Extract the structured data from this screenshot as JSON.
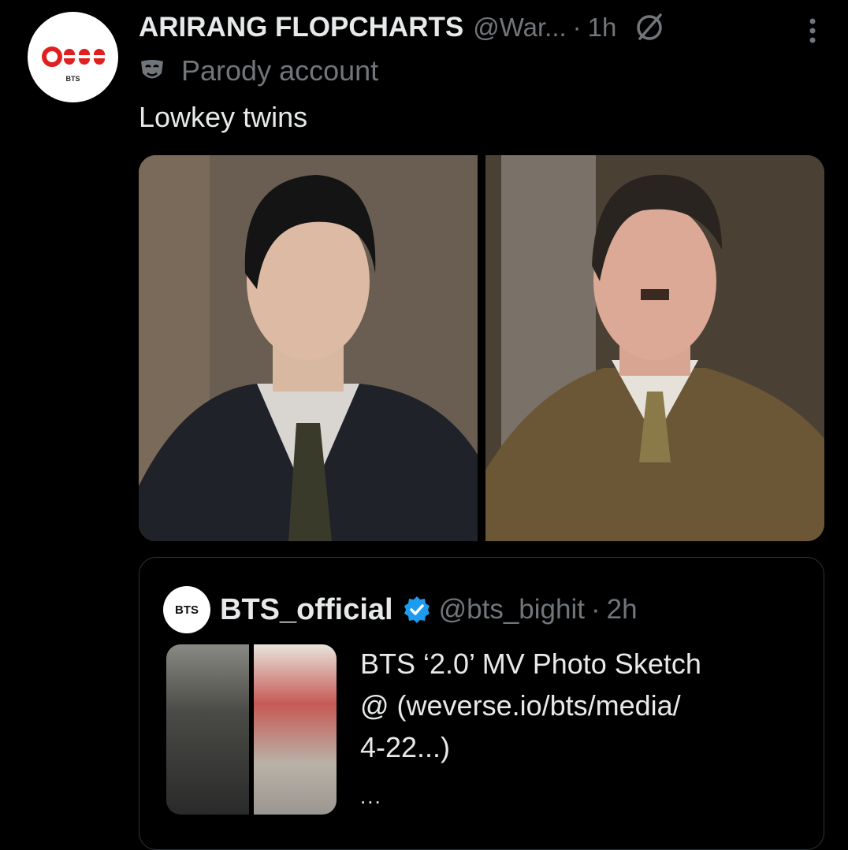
{
  "post": {
    "author_name": "ARIRANG FLOPCHARTS",
    "author_handle": "@War...",
    "separator": "·",
    "time": "1h",
    "avatar_logo_text": "BTS",
    "parody_label": "Parody account",
    "text": "Lowkey twins",
    "media": [
      {
        "kind": "photo",
        "subject": "portrait-young-man-suit"
      },
      {
        "kind": "photo",
        "subject": "portrait-man-brown-uniform"
      }
    ]
  },
  "quoted": {
    "avatar_text": "BTS",
    "name": "BTS_official",
    "handle": "@bts_bighit",
    "separator": "·",
    "time": "2h",
    "text": "BTS ‘2.0’ MV Photo Sketch\n@ (weverse.io/bts/media/\n4-22...)",
    "ellipsis": "..."
  },
  "colors": {
    "background": "#000000",
    "text_primary": "#e7e9ea",
    "text_secondary": "#71767b",
    "verified": "#1d9bf0",
    "logo_red": "#e02020"
  },
  "icons": [
    "slashed-circle-icon",
    "more-icon",
    "parody-mask-icon",
    "verified-badge-icon"
  ]
}
